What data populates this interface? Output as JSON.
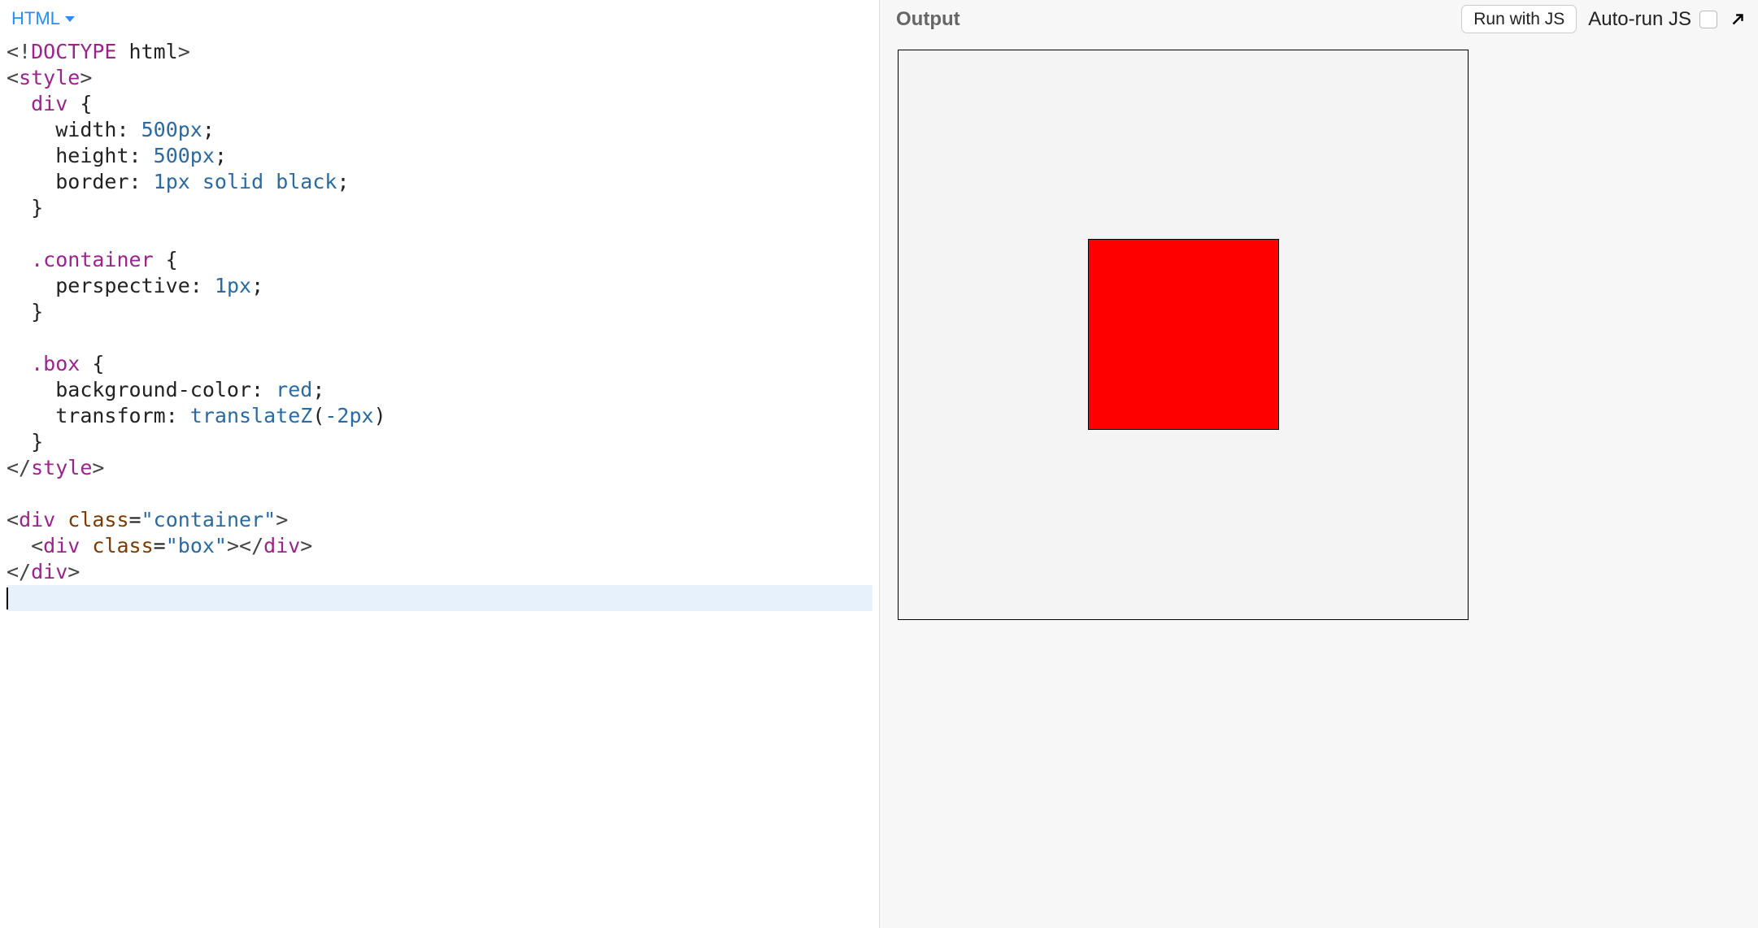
{
  "editor": {
    "tab_label": "HTML",
    "code_lines": [
      {
        "html": "<span class='tag'>&lt;!</span><span class='name'>DOCTYPE</span><span class='plain'> html</span><span class='tag'>&gt;</span>"
      },
      {
        "html": "<span class='tag'>&lt;</span><span class='name'>style</span><span class='tag'>&gt;</span>"
      },
      {
        "html": "<span class='plain'>  </span><span class='css-sel'>div</span><span class='plain'> {</span>"
      },
      {
        "html": "<span class='plain'>    </span><span class='css-prop'>width</span><span class='plain'>: </span><span class='css-num'>500px</span><span class='plain'>;</span>"
      },
      {
        "html": "<span class='plain'>    </span><span class='css-prop'>height</span><span class='plain'>: </span><span class='css-num'>500px</span><span class='plain'>;</span>"
      },
      {
        "html": "<span class='plain'>    </span><span class='css-prop'>border</span><span class='plain'>: </span><span class='css-num'>1px</span><span class='plain'> </span><span class='css-kw'>solid</span><span class='plain'> </span><span class='css-kw'>black</span><span class='plain'>;</span>"
      },
      {
        "html": "<span class='plain'>  }</span>"
      },
      {
        "html": "<span class='plain'> </span>"
      },
      {
        "html": "<span class='plain'>  </span><span class='css-sel'>.container</span><span class='plain'> {</span>"
      },
      {
        "html": "<span class='plain'>    </span><span class='css-prop'>perspective</span><span class='plain'>: </span><span class='css-num'>1px</span><span class='plain'>;</span>"
      },
      {
        "html": "<span class='plain'>  }</span>"
      },
      {
        "html": "<span class='plain'> </span>"
      },
      {
        "html": "<span class='plain'>  </span><span class='css-sel'>.box</span><span class='plain'> {</span>"
      },
      {
        "html": "<span class='plain'>    </span><span class='css-prop'>background-color</span><span class='plain'>: </span><span class='css-kw'>red</span><span class='plain'>;</span>"
      },
      {
        "html": "<span class='plain'>    </span><span class='css-prop'>transform</span><span class='plain'>: </span><span class='css-kw'>translateZ</span><span class='plain'>(</span><span class='css-num'>-2px</span><span class='plain'>)</span>"
      },
      {
        "html": "<span class='plain'>  }</span>"
      },
      {
        "html": "<span class='tag'>&lt;/</span><span class='name'>style</span><span class='tag'>&gt;</span>"
      },
      {
        "html": "<span class='plain'> </span>"
      },
      {
        "html": "<span class='tag'>&lt;</span><span class='name'>div</span><span class='plain'> </span><span class='attrn'>class</span><span class='plain'>=</span><span class='val'>\"container\"</span><span class='tag'>&gt;</span>"
      },
      {
        "html": "<span class='plain'>  </span><span class='tag'>&lt;</span><span class='name'>div</span><span class='plain'> </span><span class='attrn'>class</span><span class='plain'>=</span><span class='val'>\"box\"</span><span class='tag'>&gt;&lt;/</span><span class='name'>div</span><span class='tag'>&gt;</span>"
      },
      {
        "html": "<span class='tag'>&lt;/</span><span class='name'>div</span><span class='tag'>&gt;</span>"
      }
    ],
    "cursor_line_blank": true
  },
  "output": {
    "title": "Output",
    "run_button": "Run with JS",
    "autorun_label": "Auto-run JS",
    "autorun_checked": false
  }
}
